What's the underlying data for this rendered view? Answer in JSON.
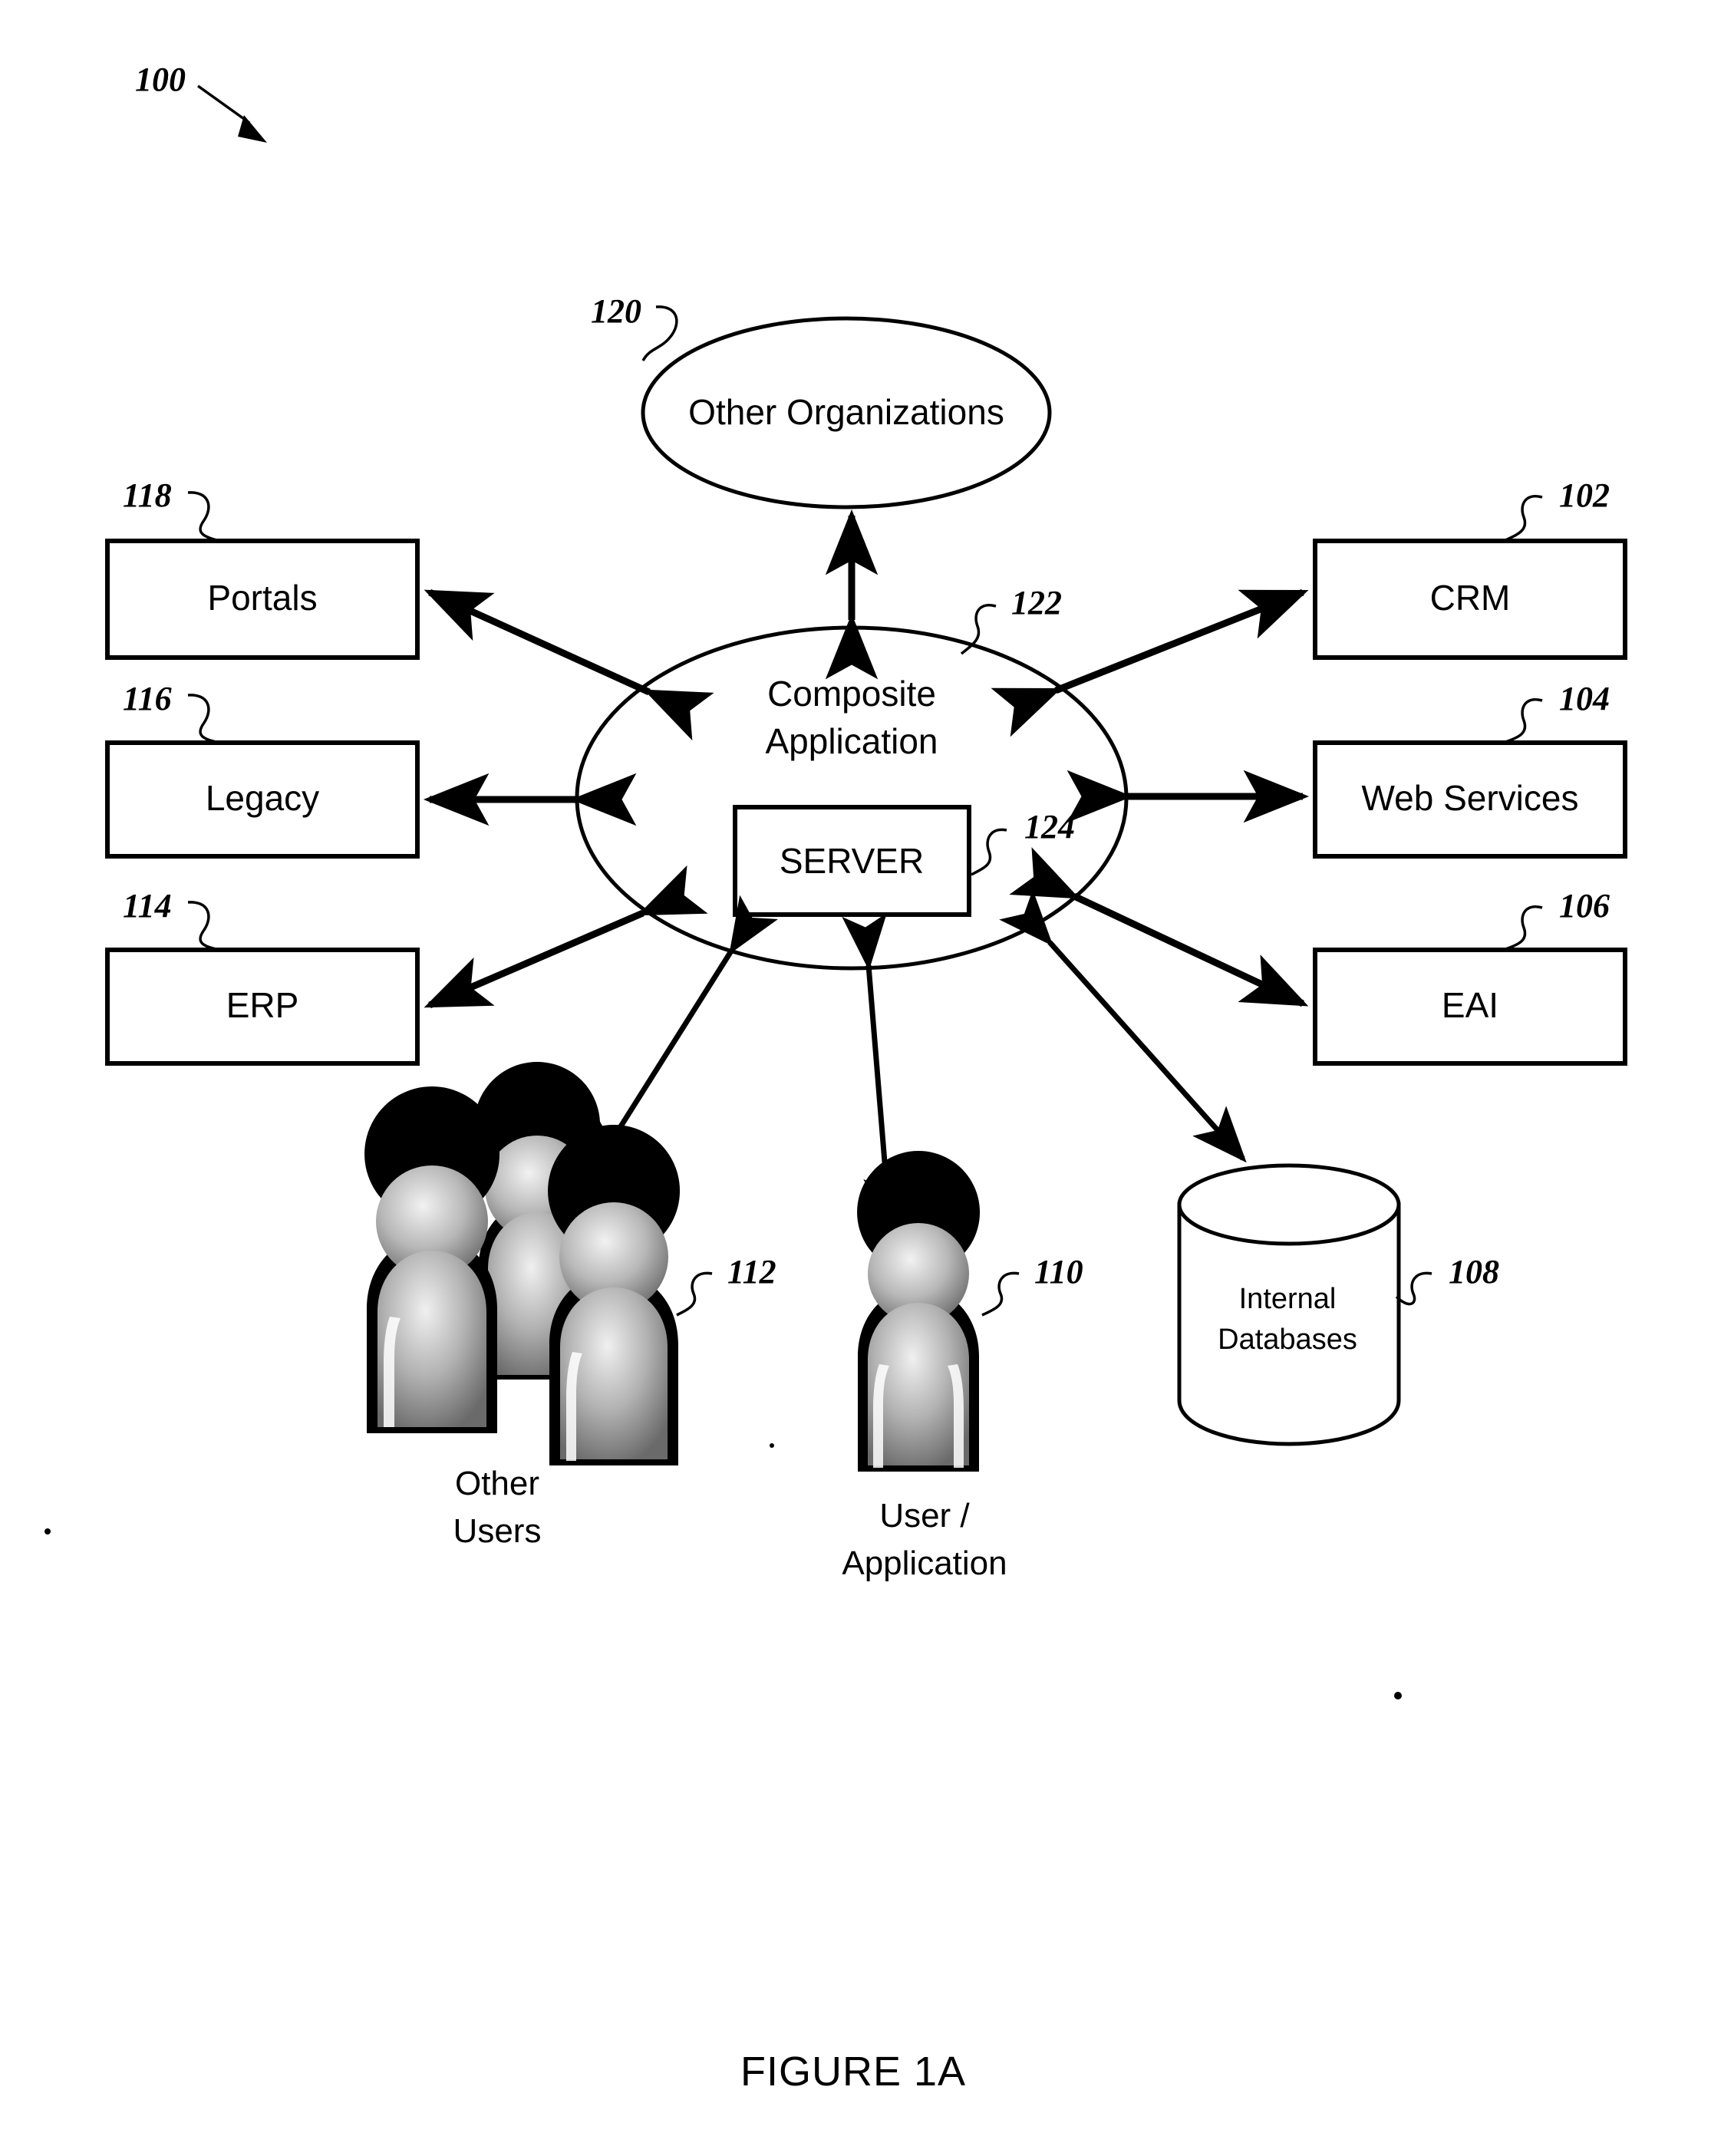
{
  "figure": {
    "caption": "FIGURE 1A",
    "system_ref": "100"
  },
  "nodes": {
    "other_organizations": {
      "label": "Other Organizations",
      "ref": "120",
      "shape": "ellipse"
    },
    "composite_application": {
      "label_line1": "Composite",
      "label_line2": "Application",
      "ref": "122",
      "shape": "ellipse"
    },
    "server": {
      "label": "SERVER",
      "ref": "124",
      "shape": "rectangle"
    },
    "portals": {
      "label": "Portals",
      "ref": "118",
      "shape": "rectangle"
    },
    "legacy": {
      "label": "Legacy",
      "ref": "116",
      "shape": "rectangle"
    },
    "erp": {
      "label": "ERP",
      "ref": "114",
      "shape": "rectangle"
    },
    "crm": {
      "label": "CRM",
      "ref": "102",
      "shape": "rectangle"
    },
    "web_services": {
      "label": "Web Services",
      "ref": "104",
      "shape": "rectangle"
    },
    "eai": {
      "label": "EAI",
      "ref": "106",
      "shape": "rectangle"
    },
    "internal_databases": {
      "label_line1": "Internal",
      "label_line2": "Databases",
      "ref": "108",
      "shape": "cylinder"
    },
    "other_users": {
      "caption_line1": "Other",
      "caption_line2": "Users",
      "ref": "112",
      "shape": "people-group"
    },
    "user_application": {
      "caption_line1": "User /",
      "caption_line2": "Application",
      "ref": "110",
      "shape": "person"
    }
  },
  "connections": [
    {
      "from": "composite_application",
      "to": "other_organizations",
      "style": "double-arrow"
    },
    {
      "from": "composite_application",
      "to": "portals",
      "style": "double-arrow"
    },
    {
      "from": "composite_application",
      "to": "legacy",
      "style": "double-arrow"
    },
    {
      "from": "composite_application",
      "to": "erp",
      "style": "double-arrow"
    },
    {
      "from": "composite_application",
      "to": "crm",
      "style": "double-arrow"
    },
    {
      "from": "composite_application",
      "to": "web_services",
      "style": "double-arrow"
    },
    {
      "from": "composite_application",
      "to": "eai",
      "style": "double-arrow"
    },
    {
      "from": "composite_application",
      "to": "other_users",
      "style": "double-arrow"
    },
    {
      "from": "composite_application",
      "to": "user_application",
      "style": "double-arrow"
    },
    {
      "from": "composite_application",
      "to": "internal_databases",
      "style": "double-arrow"
    }
  ],
  "colors": {
    "ink": "#000000",
    "paper": "#ffffff"
  }
}
